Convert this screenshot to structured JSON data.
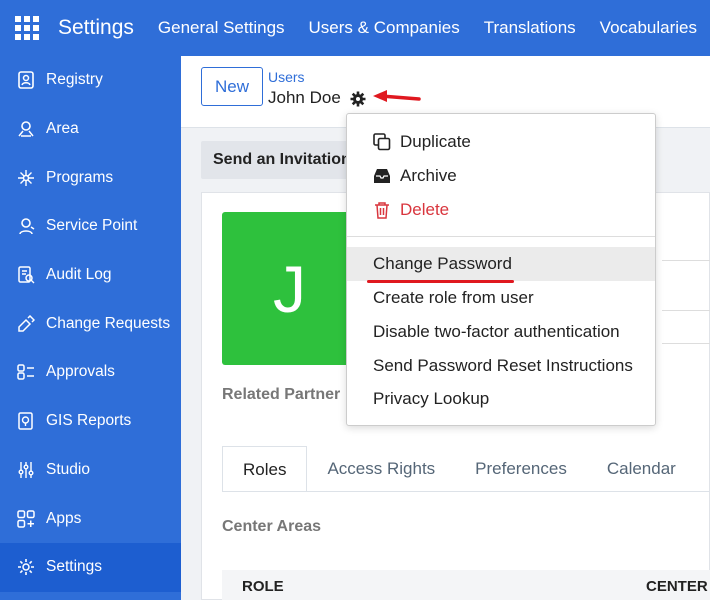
{
  "app": {
    "title": "Settings"
  },
  "topnav": [
    "General Settings",
    "Users & Companies",
    "Translations",
    "Vocabularies"
  ],
  "sidebar": {
    "items": [
      {
        "label": "Registry",
        "icon": "registry-icon"
      },
      {
        "label": "Area",
        "icon": "area-icon"
      },
      {
        "label": "Programs",
        "icon": "programs-icon"
      },
      {
        "label": "Service Point",
        "icon": "service-point-icon"
      },
      {
        "label": "Audit Log",
        "icon": "audit-log-icon"
      },
      {
        "label": "Change Requests",
        "icon": "change-requests-icon"
      },
      {
        "label": "Approvals",
        "icon": "approvals-icon"
      },
      {
        "label": "GIS Reports",
        "icon": "gis-reports-icon"
      },
      {
        "label": "Studio",
        "icon": "studio-icon"
      },
      {
        "label": "Apps",
        "icon": "apps-icon"
      },
      {
        "label": "Settings",
        "icon": "settings-icon"
      }
    ],
    "active_label": "Settings"
  },
  "control_panel": {
    "new_label": "New",
    "breadcrumb": "Users",
    "record_name": "John Doe"
  },
  "form": {
    "invite_label": "Send an Invitation",
    "avatar_letter": "J",
    "related_partner_label": "Related Partner",
    "tabs": [
      "Roles",
      "Access Rights",
      "Preferences",
      "Calendar"
    ],
    "active_tab": "Roles",
    "section_title": "Center Areas",
    "table_headers": [
      "ROLE",
      "CENTER"
    ]
  },
  "action_menu": {
    "items": [
      {
        "label": "Duplicate",
        "icon": "duplicate-icon"
      },
      {
        "label": "Archive",
        "icon": "archive-icon"
      },
      {
        "label": "Delete",
        "icon": "trash-icon"
      }
    ],
    "secondary_items": [
      "Change Password",
      "Create role from user",
      "Disable two-factor authentication",
      "Send Password Reset Instructions",
      "Privacy Lookup"
    ],
    "highlighted": "Change Password"
  },
  "colors": {
    "brand": "#2f6ed8",
    "avatar": "#2ec13d",
    "danger": "#d9363e",
    "annotation": "#e0181f"
  }
}
